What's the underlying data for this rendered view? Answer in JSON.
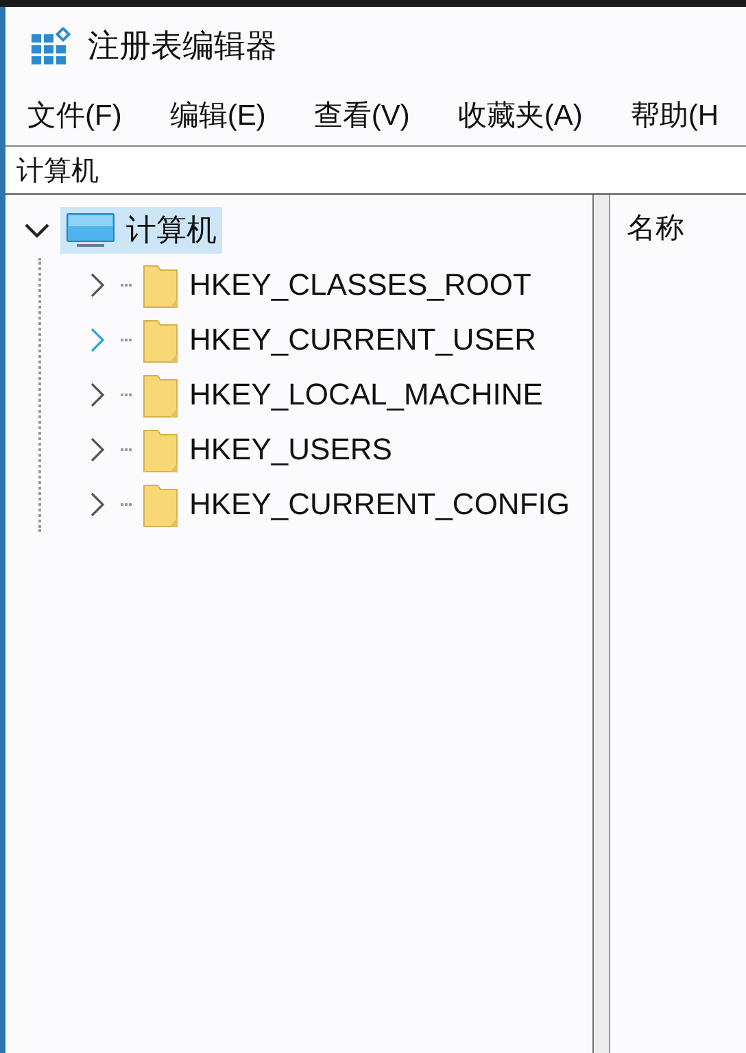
{
  "window": {
    "title": "注册表编辑器"
  },
  "menu": [
    {
      "label": "文件(F)"
    },
    {
      "label": "编辑(E)"
    },
    {
      "label": "查看(V)"
    },
    {
      "label": "收藏夹(A)"
    },
    {
      "label": "帮助(H"
    }
  ],
  "address_bar": {
    "value": "计算机"
  },
  "tree": [
    {
      "label": "计算机",
      "kind": "computer",
      "expanded": true,
      "selected": true,
      "hovered": false,
      "children": [
        {
          "label": "HKEY_CLASSES_ROOT",
          "kind": "folder",
          "expanded": false,
          "selected": false,
          "hovered": false
        },
        {
          "label": "HKEY_CURRENT_USER",
          "kind": "folder",
          "expanded": false,
          "selected": false,
          "hovered": true
        },
        {
          "label": "HKEY_LOCAL_MACHINE",
          "kind": "folder",
          "expanded": false,
          "selected": false,
          "hovered": false
        },
        {
          "label": "HKEY_USERS",
          "kind": "folder",
          "expanded": false,
          "selected": false,
          "hovered": false
        },
        {
          "label": "HKEY_CURRENT_CONFIG",
          "kind": "folder",
          "expanded": false,
          "selected": false,
          "hovered": false
        }
      ]
    }
  ],
  "list_pane": {
    "columns": [
      {
        "label": "名称"
      }
    ]
  }
}
